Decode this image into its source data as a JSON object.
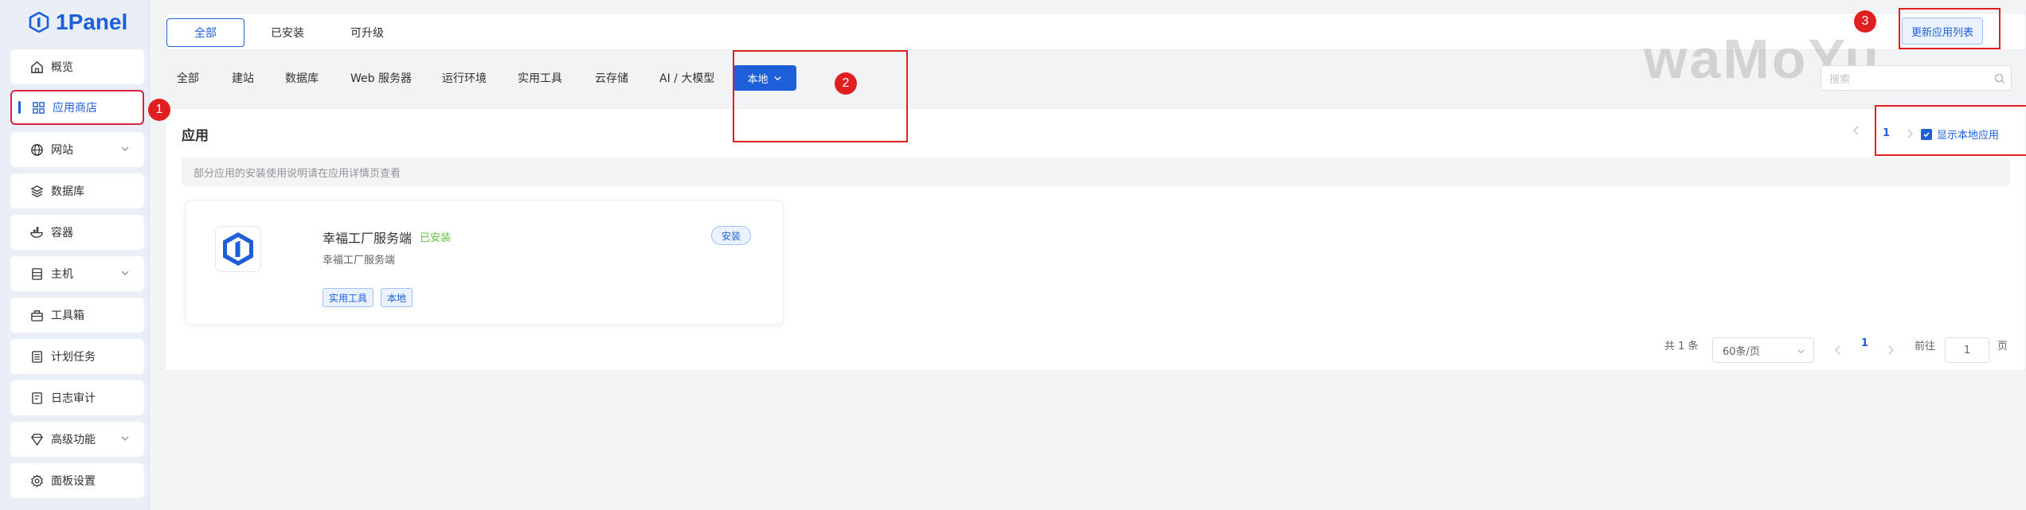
{
  "brand": {
    "name": "1Panel",
    "color": "#1d5fd9"
  },
  "sidebar": {
    "items": [
      {
        "label": "概览",
        "icon": "home-icon"
      },
      {
        "label": "应用商店",
        "icon": "app-grid-icon",
        "active": true
      },
      {
        "label": "网站",
        "icon": "globe-icon",
        "expandable": true
      },
      {
        "label": "数据库",
        "icon": "database-icon"
      },
      {
        "label": "容器",
        "icon": "docker-icon"
      },
      {
        "label": "主机",
        "icon": "server-icon",
        "expandable": true
      },
      {
        "label": "工具箱",
        "icon": "toolbox-icon"
      },
      {
        "label": "计划任务",
        "icon": "tasks-icon"
      },
      {
        "label": "日志审计",
        "icon": "log-icon"
      },
      {
        "label": "高级功能",
        "icon": "diamond-icon",
        "expandable": true
      },
      {
        "label": "面板设置",
        "icon": "gear-icon"
      }
    ]
  },
  "top_tabs": [
    {
      "label": "全部",
      "active": true
    },
    {
      "label": "已安装"
    },
    {
      "label": "可升级"
    }
  ],
  "update_button": "更新应用列表",
  "watermark": "waMoYu",
  "categories": [
    "全部",
    "建站",
    "数据库",
    "Web 服务器",
    "运行环境",
    "实用工具",
    "云存储",
    "AI / 大模型"
  ],
  "category_active": "本地",
  "search": {
    "placeholder": "搜索"
  },
  "panel": {
    "title": "应用",
    "notice": "部分应用的安装使用说明请在应用详情页查看",
    "page": "1",
    "show_local_label": "显示本地应用",
    "show_local_checked": true
  },
  "app": {
    "name": "幸福工厂服务端",
    "status": "已安装",
    "description": "幸福工厂服务端",
    "install_label": "安装",
    "tags": [
      "实用工具",
      "本地"
    ]
  },
  "pagination": {
    "total": "共 1 条",
    "page_size": "60条/页",
    "current": "1",
    "goto_label": "前往",
    "goto_value": "1",
    "page_suffix": "页"
  },
  "annotations": [
    "1",
    "2",
    "3"
  ],
  "colors": {
    "accent": "#1d5fd9",
    "annotation": "#e02020",
    "success": "#67c23a"
  }
}
